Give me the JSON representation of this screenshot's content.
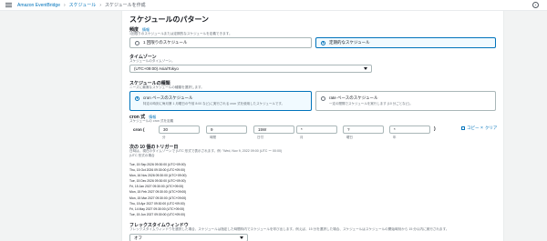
{
  "breadcrumb": [
    "Amazon EventBridge",
    "スケジュール",
    "スケジュールを作成"
  ],
  "page_title": "スケジュールのパターン",
  "occurrence": {
    "label": "頻度",
    "info": "情報",
    "desc": "1回限りのスケジュールまたは定期的なスケジュールを定義できます。",
    "options": [
      "1 回限りのスケジュール",
      "定期的なスケジュール"
    ],
    "selected": 1
  },
  "timezone": {
    "label": "タイムゾーン",
    "desc": "スケジュールのタイムゾーン。",
    "value": "(UTC+09:00) Asia/Tokyo"
  },
  "schedule_type": {
    "label": "スケジュールの種類",
    "desc": "ニーズに最適なスケジュールの種類を選択します。",
    "options": [
      {
        "title": "cron ベースのスケジュール",
        "sub": "特定の時刻に毎月第 1 月曜日の午前 8:00 など)に実行される cron 式を使用したスケジュールです。"
      },
      {
        "title": "rate ベースのスケジュール",
        "sub": "一定の間隔でスケジュールを実行します (10 分ごとなど)。"
      }
    ],
    "selected": 0
  },
  "cron": {
    "label": "cron 式",
    "info": "情報",
    "desc": "スケジュールの cron 式を定義",
    "prefix": "cron (",
    "suffix": ")",
    "fields": [
      {
        "value": "30",
        "unit": "分"
      },
      {
        "value": "9",
        "unit": "時間"
      },
      {
        "value": "15W",
        "unit": "日付"
      },
      {
        "value": "*",
        "unit": "月"
      },
      {
        "value": "?",
        "unit": "曜日"
      },
      {
        "value": "*",
        "unit": "年"
      }
    ],
    "copy_label": "コピー",
    "clear_label": "クリア"
  },
  "next_triggers": {
    "title": "次の 10 個のトリガー日",
    "desc1": "日時は、現在のタイムゾーンで (UTC 形式で表示されます。例: \"Wed, Nov 9, 2022 09:00 (UTC ー 00:00)",
    "desc2": "(UTC 形式の場合",
    "dates": [
      "Tue, 15 Sep 2026 09:30:00 (UTC+09:00)",
      "Thu, 15 Oct 2026 09:30:00 (UTC+09:00)",
      "Mon, 16 Nov 2026 09:30:00 (UTC+09:00)",
      "Tue, 15 Dec 2026 09:30:00 (UTC+09:00)",
      "Fri, 15 Jan 2027 09:30:00 (UTC+09:00)",
      "Mon, 15 Feb 2027 09:30:00 (UTC+09:00)",
      "Mon, 15 Mar 2027 09:30:00 (UTC+09:00)",
      "Thu, 15 Apr 2027 09:30:00 (UTC+09:00)",
      "Fri, 14 May 2027 09:30:00 (UTC+09:00)",
      "Tue, 15 Jun 2027 09:30:00 (UTC+09:00)"
    ]
  },
  "flex_window": {
    "title": "フレックスタイムウィンドウ",
    "desc": "フレックスタイムウィンドウを選択した場合、スケジュールは指定した時間枠内でスケジュールを呼び出します。例えば、15 分を選択した場合、スケジュールはスケジュールの開始時刻から 15 分以内に実行されます。",
    "value": "オフ"
  }
}
